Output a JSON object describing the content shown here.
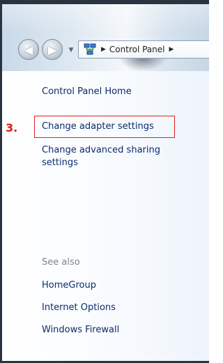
{
  "address_bar": {
    "breadcrumb": "Control Panel",
    "icon": "network-icon"
  },
  "nav": {
    "back_icon": "back-arrow-icon",
    "forward_icon": "forward-arrow-icon",
    "dropdown_icon": "chevron-down-icon"
  },
  "left_pane": {
    "home_link": "Control Panel Home",
    "adapter_link": "Change adapter settings",
    "advanced_link_line1": "Change advanced sharing",
    "advanced_link_line2": "settings",
    "see_also_label": "See also",
    "see_also_links": [
      "HomeGroup",
      "Internet Options",
      "Windows Firewall"
    ]
  },
  "annotation": {
    "step_label": "3.",
    "color": "#e01b1b"
  }
}
